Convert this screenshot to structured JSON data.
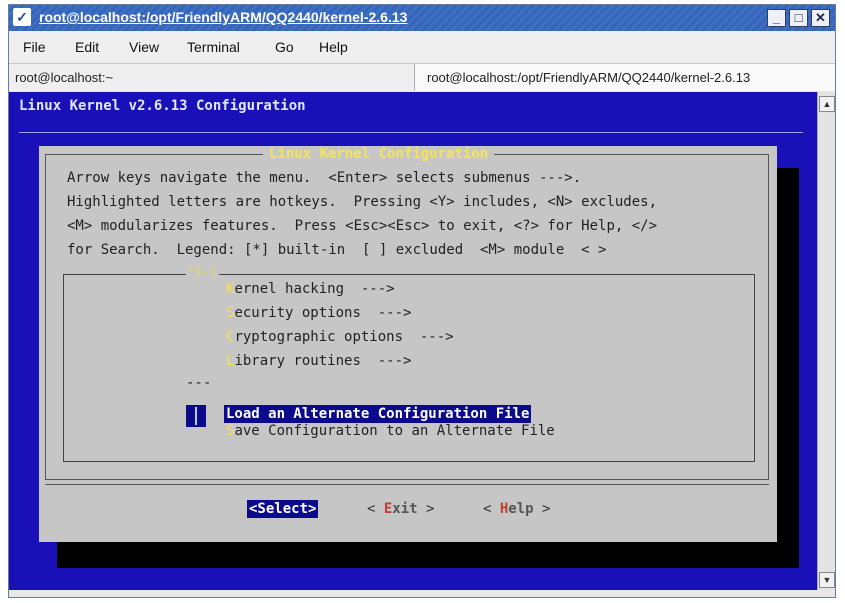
{
  "window": {
    "title": "root@localhost:/opt/FriendlyARM/QQ2440/kernel-2.6.13",
    "buttons": [
      "_",
      "□",
      "✕"
    ]
  },
  "menu": [
    "File",
    "Edit",
    "View",
    "Terminal",
    "Go",
    "Help"
  ],
  "tabs": [
    "root@localhost:~",
    "root@localhost:/opt/FriendlyARM/QQ2440/kernel-2.6.13"
  ],
  "terminal": {
    "header": "Linux Kernel v2.6.13 Configuration",
    "dialog_title": "Linux Kernel Configuration",
    "help_lines": [
      "Arrow keys navigate the menu.  <Enter> selects submenus --->.",
      "Highlighted letters are hotkeys.  Pressing <Y> includes, <N> excludes,",
      "<M> modularizes features.  Press <Esc><Esc> to exit, <?> for Help, </>",
      "for Search.  Legend: [*] built-in  [ ] excluded  <M> module  < >"
    ],
    "more_indicator": "^(-)",
    "items": [
      {
        "hot": "K",
        "rest": "ernel hacking  --->"
      },
      {
        "hot": "S",
        "rest": "ecurity options  --->"
      },
      {
        "hot": "C",
        "rest": "ryptographic options  --->"
      },
      {
        "hot": "L",
        "rest": "ibrary routines  --->"
      }
    ],
    "separator": "---",
    "selected_item": "Load an Alternate Configuration File",
    "last_item": {
      "hot": "S",
      "rest": "ave Configuration to an Alternate File"
    },
    "buttons": {
      "select": "<Select>",
      "exit_open": "< ",
      "exit_hot": "E",
      "exit_rest": "xit",
      "exit_close": " >",
      "help_open": "< ",
      "help_hot": "H",
      "help_rest": "elp",
      "help_close": " >"
    }
  },
  "colors": {
    "terminal_bg": "#1a10b8",
    "dialog_bg": "#c6c6c6",
    "highlight": "#0a0a8a",
    "hotkey": "#f5e14a"
  }
}
